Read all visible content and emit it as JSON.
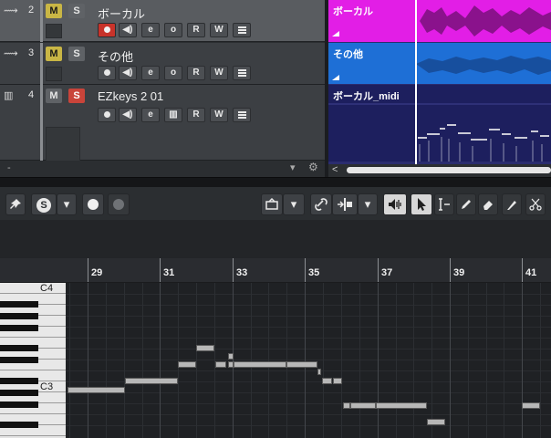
{
  "tracks": [
    {
      "number": "2",
      "type_icon": "audio-waveform-icon",
      "mute_label": "M",
      "solo_label": "S",
      "name": "ボーカル",
      "mute_active": true,
      "rec_active": true,
      "selected": true,
      "controls": {
        "monitor": "◀)",
        "edit": "e",
        "read": "R",
        "write": "W"
      }
    },
    {
      "number": "3",
      "type_icon": "audio-waveform-icon",
      "mute_label": "M",
      "solo_label": "S",
      "name": "その他",
      "mute_active": true,
      "rec_active": false,
      "selected": false,
      "controls": {
        "monitor": "◀)",
        "edit": "e",
        "read": "R",
        "write": "W"
      }
    },
    {
      "number": "4",
      "type_icon": "instrument-keys-icon",
      "mute_label": "M",
      "solo_label": "S",
      "name": "EZkeys 2 01",
      "mute_active": false,
      "solo_active": true,
      "rec_active": false,
      "selected": false,
      "controls": {
        "monitor": "◀)",
        "edit": "e",
        "read": "R",
        "write": "W"
      }
    }
  ],
  "events": {
    "vocal": "ボーカル",
    "other": "その他",
    "midi": "ボーカル_midi"
  },
  "colors": {
    "vocal_event": "#e21ee6",
    "other_event": "#1e6fd6",
    "midi_event": "#1d1f5e",
    "mute_on": "#c9b645",
    "solo_on": "#c9443a",
    "rec_on": "#c8332a"
  },
  "toolbar": {
    "solo_label": "S",
    "dropdown_glyph": "▾",
    "icons": [
      "pin-icon",
      "solo-icon",
      "record-dot-icon",
      "moon-icon",
      "snap-settings-icon",
      "link-icon",
      "quantize-icon",
      "speaker-icon",
      "pointer-icon",
      "range-select-icon",
      "pencil-icon",
      "eraser-icon",
      "knife-icon",
      "scissors-icon"
    ]
  },
  "ruler": {
    "bars": [
      "29",
      "31",
      "33",
      "35",
      "37",
      "39",
      "41"
    ]
  },
  "keyboard": {
    "labels": {
      "c4": "C4",
      "c3": "C3"
    }
  },
  "footer": {
    "dash": "-",
    "dropdown": "▾",
    "gear": "⚙"
  },
  "arrange_scroll": {
    "left_arrow": "<"
  }
}
